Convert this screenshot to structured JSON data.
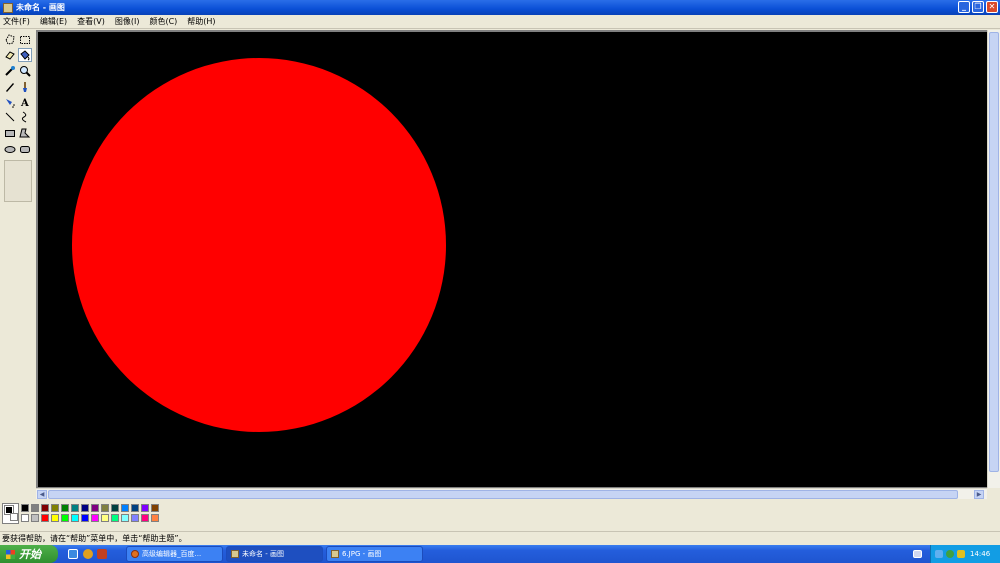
{
  "window": {
    "title": "未命名 - 画图",
    "controls": [
      "minimize",
      "restore",
      "close"
    ]
  },
  "menu": [
    "文件(F)",
    "编辑(E)",
    "查看(V)",
    "图像(I)",
    "颜色(C)",
    "帮助(H)"
  ],
  "tools": [
    {
      "name": "free-select-icon"
    },
    {
      "name": "rect-select-icon"
    },
    {
      "name": "eraser-icon"
    },
    {
      "name": "fill-icon",
      "selected": true
    },
    {
      "name": "color-picker-icon"
    },
    {
      "name": "magnifier-icon"
    },
    {
      "name": "pencil-icon"
    },
    {
      "name": "brush-icon"
    },
    {
      "name": "airbrush-icon"
    },
    {
      "name": "text-icon"
    },
    {
      "name": "line-icon"
    },
    {
      "name": "curve-icon"
    },
    {
      "name": "rectangle-icon"
    },
    {
      "name": "polygon-icon"
    },
    {
      "name": "ellipse-icon"
    },
    {
      "name": "rounded-rect-icon"
    }
  ],
  "canvas": {
    "background": "#000000",
    "shape_color": "#ff0000"
  },
  "palette": {
    "foreground": "#000000",
    "background": "#ffffff",
    "top_row": [
      "#000000",
      "#808080",
      "#800000",
      "#808000",
      "#008000",
      "#008080",
      "#000080",
      "#800080",
      "#808040",
      "#004040",
      "#0080ff",
      "#004080",
      "#8000ff",
      "#804000"
    ],
    "bottom_row": [
      "#ffffff",
      "#c0c0c0",
      "#ff0000",
      "#ffff00",
      "#00ff00",
      "#00ffff",
      "#0000ff",
      "#ff00ff",
      "#ffff80",
      "#00ff80",
      "#80ffff",
      "#8080ff",
      "#ff0080",
      "#ff8040"
    ]
  },
  "status": "要获得帮助，请在“帮助”菜单中，单击“帮助主题”。",
  "taskbar": {
    "start_label": "开始",
    "tasks": [
      {
        "label": "高级编辑器_百度...",
        "icon": "firefox-icon"
      },
      {
        "label": "未命名 - 画图",
        "icon": "paint-icon",
        "active": true
      },
      {
        "label": "6.JPG - 画图",
        "icon": "paint-icon"
      }
    ],
    "clock": "14:46"
  }
}
